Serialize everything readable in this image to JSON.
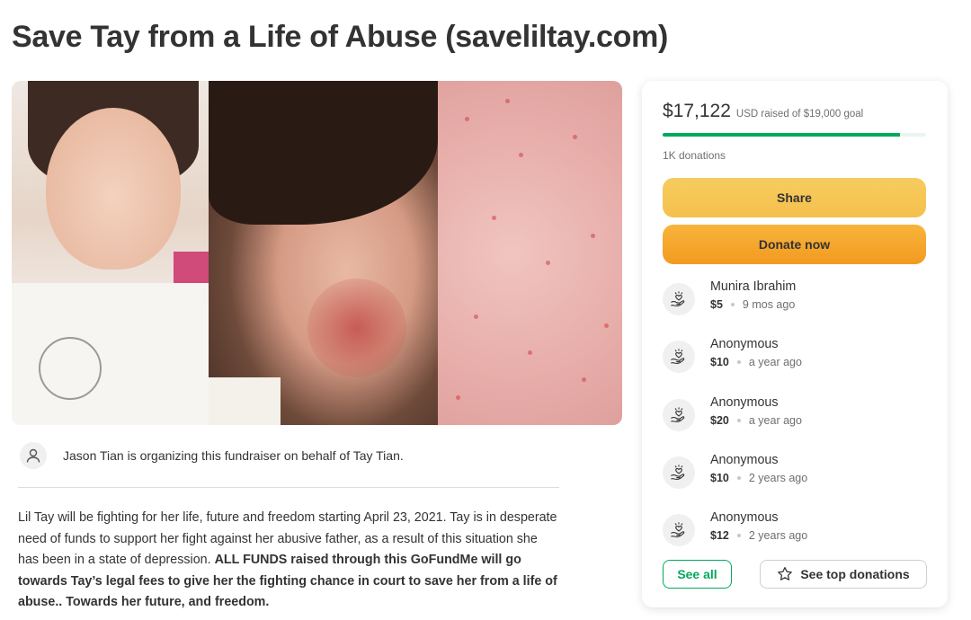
{
  "page": {
    "title": "Save Tay from a Life of Abuse (saveliltay.com)"
  },
  "organizer": {
    "text": "Jason Tian is organizing this fundraiser on behalf of Tay Tian."
  },
  "story": {
    "intro": "Lil Tay will be fighting for her life, future and freedom starting April 23, 2021. Tay is in desperate need of funds to support her fight against her abusive father, as a result of this situation she has been in a state of depression. ",
    "bold": "ALL FUNDS raised through this GoFundMe will go towards Tay’s legal fees to give her the fighting chance in court to save her from a life of abuse.. Towards her future, and freedom."
  },
  "donation_card": {
    "raised": "$17,122",
    "goal_text": "USD raised of $19,000 goal",
    "progress_fraction": 0.9,
    "donation_count": "1K donations",
    "share_label": "Share",
    "donate_label": "Donate now",
    "see_all_label": "See all",
    "see_top_label": "See top donations",
    "donations": [
      {
        "name": "Munira Ibrahim",
        "amount": "$5",
        "time": "9 mos ago"
      },
      {
        "name": "Anonymous",
        "amount": "$10",
        "time": "a year ago"
      },
      {
        "name": "Anonymous",
        "amount": "$20",
        "time": "a year ago"
      },
      {
        "name": "Anonymous",
        "amount": "$10",
        "time": "2 years ago"
      },
      {
        "name": "Anonymous",
        "amount": "$12",
        "time": "2 years ago"
      }
    ]
  },
  "colors": {
    "brand_green": "#02a95c",
    "share_yellow": "#f5c04d",
    "donate_orange": "#f39a20"
  },
  "icons": {
    "organizer": "user-icon",
    "donor": "heart-hand-icon",
    "top_donations": "star-icon"
  }
}
